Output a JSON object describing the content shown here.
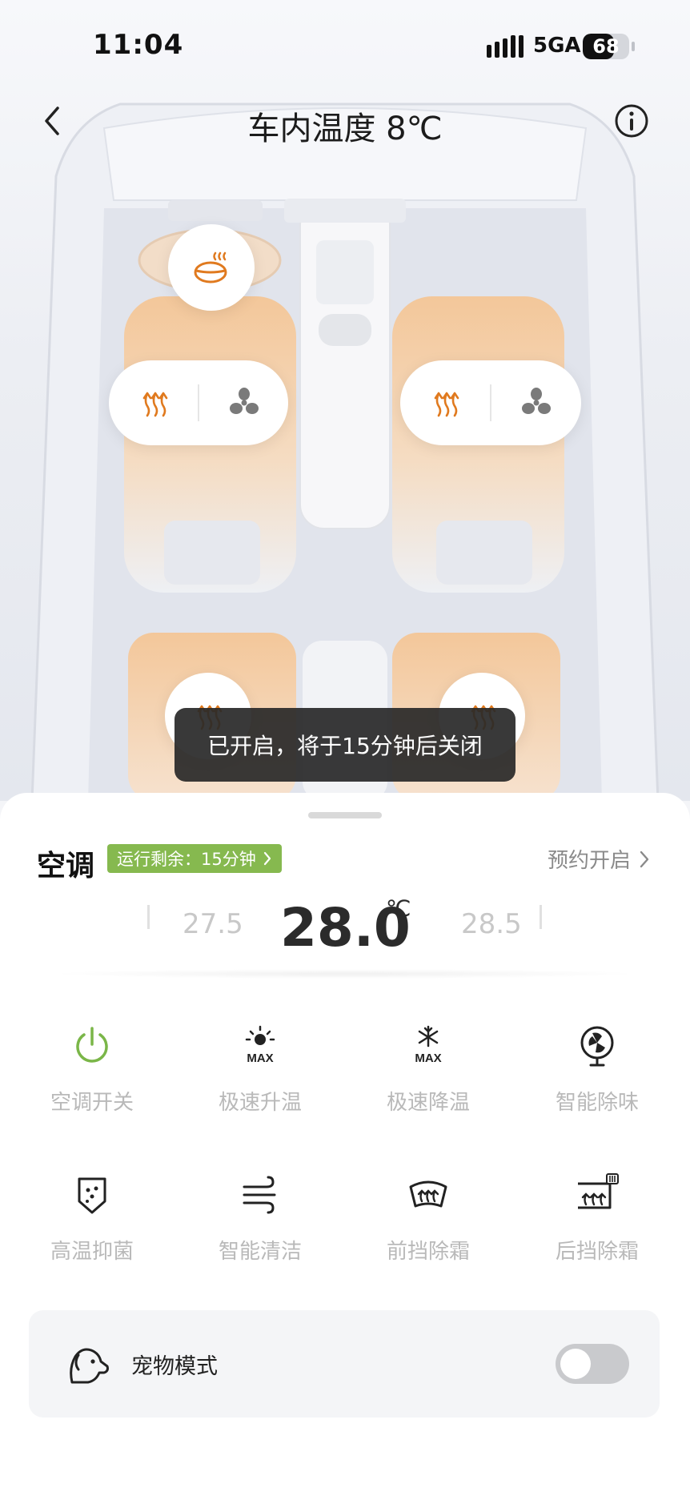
{
  "status_bar": {
    "time": "11:04",
    "network": "5GA",
    "battery_percent": "68",
    "battery_level": 0.68
  },
  "header": {
    "title": "车内温度 8℃"
  },
  "seat_controls": {
    "driver_heat_icon": "seat-heat-icon",
    "driver_vent_icon": "fan-icon",
    "passenger_heat_icon": "seat-heat-icon",
    "passenger_vent_icon": "fan-icon",
    "steering_heat_icon": "steering-wheel-heat-icon",
    "rear_left_heat_icon": "seat-heat-icon",
    "rear_right_heat_icon": "seat-heat-icon"
  },
  "toast": {
    "text": "已开启，将于15分钟后关闭"
  },
  "ac_panel": {
    "title": "空调",
    "run_badge": "运行剩余：15分钟",
    "schedule_label": "预约开启",
    "temperature": {
      "current": "28.0",
      "unit": "℃",
      "lower": "27.5",
      "higher": "28.5"
    }
  },
  "functions": [
    {
      "label": "空调开关",
      "icon": "power-icon"
    },
    {
      "label": "极速升温",
      "icon": "sun-max-icon"
    },
    {
      "label": "极速降温",
      "icon": "snowflake-max-icon"
    },
    {
      "label": "智能除味",
      "icon": "fan-deodorize-icon"
    },
    {
      "label": "高温抑菌",
      "icon": "shield-sterilize-icon"
    },
    {
      "label": "智能清洁",
      "icon": "wind-clean-icon"
    },
    {
      "label": "前挡除霜",
      "icon": "front-defrost-icon"
    },
    {
      "label": "后挡除霜",
      "icon": "rear-defrost-icon"
    }
  ],
  "pet_mode": {
    "label": "宠物模式",
    "enabled": false
  },
  "colors": {
    "accent_orange": "#e07a1f",
    "accent_green": "#86b94f",
    "power_green": "#7ab648"
  }
}
